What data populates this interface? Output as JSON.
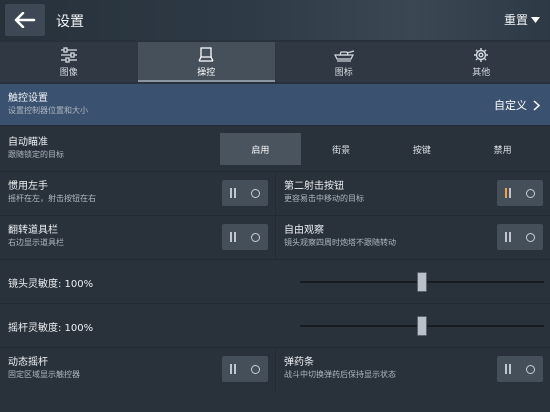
{
  "header": {
    "title": "设置",
    "reset_label": "重置"
  },
  "tabs": [
    {
      "label": "图像",
      "icon": "sliders-icon",
      "active": false
    },
    {
      "label": "操控",
      "icon": "gamepad-icon",
      "active": true
    },
    {
      "label": "图标",
      "icon": "tank-icon",
      "active": false
    },
    {
      "label": "其他",
      "icon": "gear-icon",
      "active": false
    }
  ],
  "touch_settings": {
    "title": "触控设置",
    "subtitle": "设置控制器位置和大小",
    "value": "自定义"
  },
  "auto_aim": {
    "title": "自动瞄准",
    "subtitle": "跟随锁定的目标",
    "options": [
      "启用",
      "街景",
      "按键",
      "禁用"
    ],
    "selected": "启用"
  },
  "toggles": {
    "left_hand": {
      "title": "惯用左手",
      "subtitle": "摇杆在左，射击按钮在右",
      "on": false
    },
    "second_fire": {
      "title": "第二射击按钮",
      "subtitle": "更容易击中移动的目标",
      "on": true
    },
    "flip_bar": {
      "title": "翻转道具栏",
      "subtitle": "右边显示道具栏",
      "on": false
    },
    "free_look": {
      "title": "自由观察",
      "subtitle": "镜头观察四周时炮塔不跟随转动",
      "on": false
    },
    "dynamic_stick": {
      "title": "动态摇杆",
      "subtitle": "固定区域显示触控器",
      "on": false
    },
    "ammo_bar": {
      "title": "弹药条",
      "subtitle": "战斗中切换弹药后保持显示状态",
      "on": false
    }
  },
  "sliders": {
    "camera": {
      "label": "镜头灵敏度: 100%",
      "value": 100,
      "level": 0.5
    },
    "joystick": {
      "label": "摇杆灵敏度: 100%",
      "value": 100,
      "level": 0.5
    }
  },
  "colors": {
    "accent_on": "#f1a43a",
    "selected_row": "#3a5270",
    "background": "#29313b"
  }
}
